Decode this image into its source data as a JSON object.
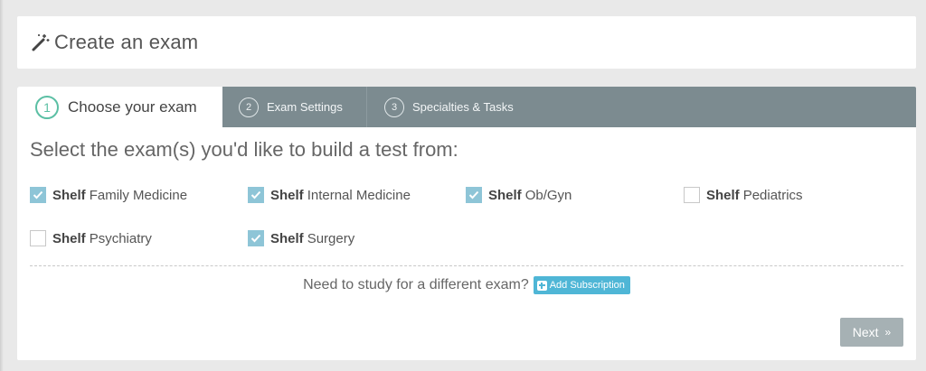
{
  "header": {
    "title": "Create an exam",
    "icon": "magic-wand-icon"
  },
  "tabs": [
    {
      "step": "1",
      "label": "Choose your exam",
      "active": true
    },
    {
      "step": "2",
      "label": "Exam Settings",
      "active": false
    },
    {
      "step": "3",
      "label": "Specialties & Tasks",
      "active": false
    }
  ],
  "heading": "Select the exam(s) you'd like to build a test from:",
  "options": [
    {
      "prefix": "Shelf",
      "name": "Family Medicine",
      "checked": true
    },
    {
      "prefix": "Shelf",
      "name": "Internal Medicine",
      "checked": true
    },
    {
      "prefix": "Shelf",
      "name": "Ob/Gyn",
      "checked": true
    },
    {
      "prefix": "Shelf",
      "name": "Pediatrics",
      "checked": false
    },
    {
      "prefix": "Shelf",
      "name": "Psychiatry",
      "checked": false
    },
    {
      "prefix": "Shelf",
      "name": "Surgery",
      "checked": true
    }
  ],
  "promo": {
    "text": "Need to study for a different exam?",
    "button_label": "Add Subscription"
  },
  "next": {
    "label": "Next",
    "icon": "double-chevron-right-icon"
  },
  "colors": {
    "accent_green": "#5bbfa4",
    "tabbar": "#7c8b90",
    "checkbox_checked": "#8ec5d7",
    "subscription_button": "#4fb6d6",
    "next_button": "#a6b1b4"
  }
}
